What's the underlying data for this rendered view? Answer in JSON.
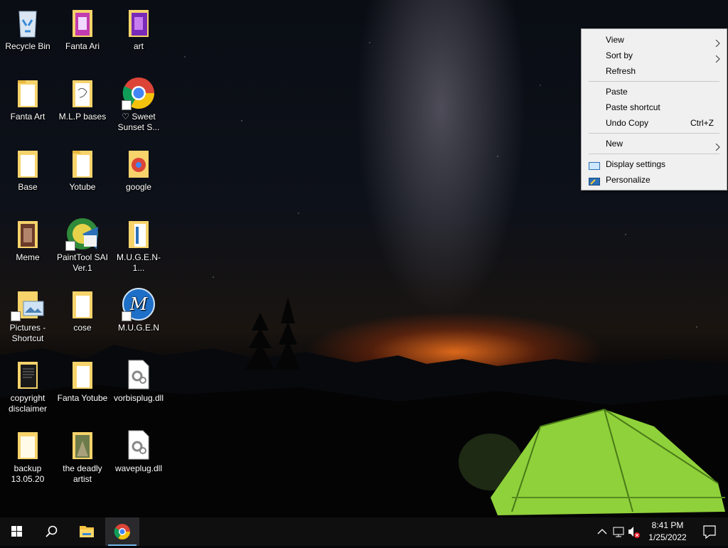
{
  "desktop_icons": [
    {
      "label": "Recycle Bin",
      "icon": "recycle-bin-icon"
    },
    {
      "label": "Fanta Ari",
      "icon": "folder-icon"
    },
    {
      "label": "art",
      "icon": "folder-icon"
    },
    {
      "label": "Fanta Art",
      "icon": "folder-icon"
    },
    {
      "label": "M.L.P bases",
      "icon": "folder-icon"
    },
    {
      "label": "♡ Sweet Sunset S...",
      "icon": "chrome-icon"
    },
    {
      "label": "Base",
      "icon": "folder-icon"
    },
    {
      "label": "Yotube",
      "icon": "folder-icon"
    },
    {
      "label": "google",
      "icon": "folder-icon"
    },
    {
      "label": "Meme",
      "icon": "folder-icon"
    },
    {
      "label": "PaintTool SAI Ver.1",
      "icon": "painttool-sai-icon"
    },
    {
      "label": "M.U.G.E.N-1...",
      "icon": "folder-icon"
    },
    {
      "label": "Pictures - Shortcut",
      "icon": "folder-icon"
    },
    {
      "label": "cose",
      "icon": "folder-icon"
    },
    {
      "label": "M.U.G.E.N",
      "icon": "mugen-icon"
    },
    {
      "label": "copyright disclaimer",
      "icon": "folder-icon"
    },
    {
      "label": "Fanta Yotube",
      "icon": "folder-icon"
    },
    {
      "label": "vorbisplug.dll",
      "icon": "dll-file-icon"
    },
    {
      "label": "backup 13.05.20",
      "icon": "folder-icon"
    },
    {
      "label": "the deadly artist",
      "icon": "folder-icon"
    },
    {
      "label": "waveplug.dll",
      "icon": "dll-file-icon"
    }
  ],
  "context_menu": {
    "view": "View",
    "sort_by": "Sort by",
    "refresh": "Refresh",
    "paste": "Paste",
    "paste_shortcut": "Paste shortcut",
    "undo_copy": "Undo Copy",
    "undo_copy_shortcut": "Ctrl+Z",
    "new": "New",
    "display_settings": "Display settings",
    "personalize": "Personalize",
    "submenu_arrow": "›"
  },
  "taskbar": {
    "pinned": [
      "start-icon",
      "search-icon",
      "file-explorer-icon",
      "chrome-icon"
    ],
    "tray": [
      "chevron-up-icon",
      "network-icon",
      "volume-muted-icon"
    ],
    "time": "8:41 PM",
    "date": "1/25/2022",
    "action_center": "notification-icon"
  },
  "colors": {
    "menu_bg": "#f0f0f0",
    "taskbar_bg": "#0f0f10",
    "folder_yellow": "#f6d36b",
    "tent_green": "#8fd13a",
    "sunset_orange": "#ff7a1e"
  }
}
